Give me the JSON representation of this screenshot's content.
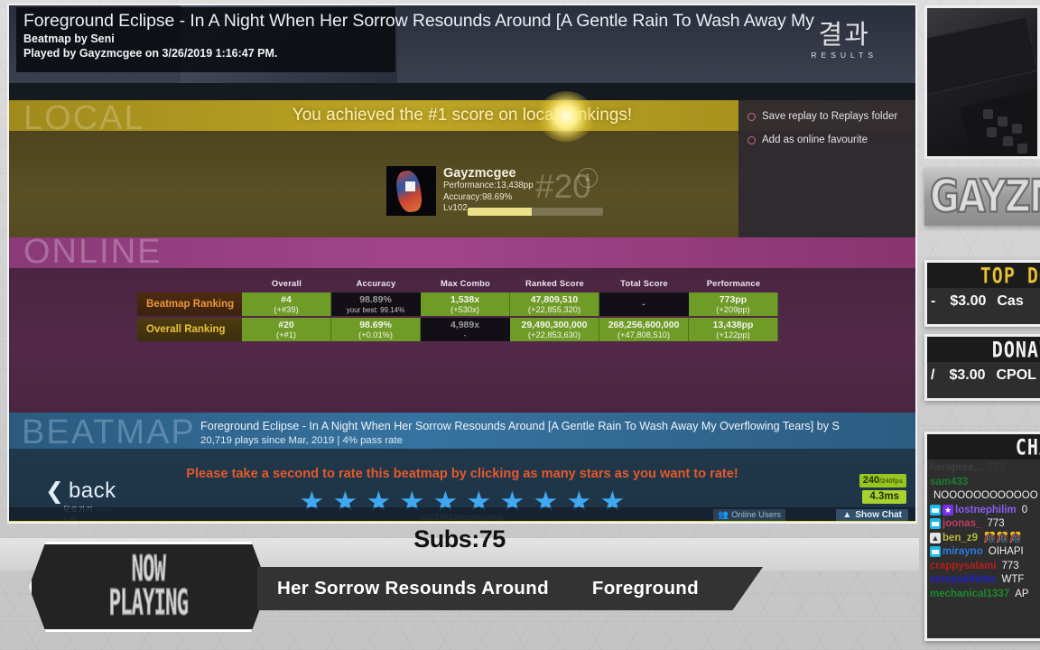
{
  "osu": {
    "song_title": "Foreground Eclipse - In A Night When Her Sorrow Resounds Around [A Gentle Rain To Wash Away My",
    "beatmap_by": "Beatmap by Seni",
    "played_by": "Played by Gayzmcgee on 3/26/2019 1:16:47 PM.",
    "results_kr": "결과",
    "results_en": "RESULTS",
    "achievement": "You achieved the #1 score on local rankings!",
    "watermarks": {
      "local": "LOCAL",
      "online": "ONLINE",
      "beatmap": "BEATMAP"
    },
    "options": [
      {
        "label": "Save replay to Replays folder"
      },
      {
        "label": "Add as online favourite"
      }
    ],
    "score_card": {
      "username": "Gayzmcgee",
      "performance": "Performance:13,438pp",
      "accuracy": "Accuracy:98.69%",
      "level": "Lv102",
      "rank": "#20",
      "rank_badge": "1",
      "level_progress_pct": 47
    },
    "rank_table": {
      "columns": [
        "Overall",
        "Accuracy",
        "Max Combo",
        "Ranked Score",
        "Total Score",
        "Performance"
      ],
      "rows": [
        {
          "label": "Beatmap Ranking",
          "cells": [
            {
              "v1": "#4",
              "v2": "(+#39)",
              "style": "green"
            },
            {
              "v1": "98.89%",
              "v2": "your best: 99.14%",
              "style": "dark"
            },
            {
              "v1": "1,538x",
              "v2": "(+530x)",
              "style": "green"
            },
            {
              "v1": "47,809,510",
              "v2": "(+22,855,320)",
              "style": "green"
            },
            {
              "v1": "-",
              "v2": "",
              "style": "dark"
            },
            {
              "v1": "773pp",
              "v2": "(+209pp)",
              "style": "green"
            }
          ]
        },
        {
          "label": "Overall Ranking",
          "cells": [
            {
              "v1": "#20",
              "v2": "(+#1)",
              "style": "green"
            },
            {
              "v1": "98.69%",
              "v2": "(+0.01%)",
              "style": "green"
            },
            {
              "v1": "4,989x",
              "v2": "-",
              "style": "dark"
            },
            {
              "v1": "29,490,300,000",
              "v2": "(+22,853,630)",
              "style": "green"
            },
            {
              "v1": "268,256,600,000",
              "v2": "(+47,808,510)",
              "style": "green"
            },
            {
              "v1": "13,438pp",
              "v2": "(+122pp)",
              "style": "green"
            }
          ]
        }
      ]
    },
    "beatmap_info": {
      "title": "Foreground Eclipse - In A Night When Her Sorrow Resounds Around [A Gentle Rain To Wash Away My Overflowing Tears] by S",
      "stats": "20,719 plays since Mar, 2019 | 4% pass rate"
    },
    "rate_prompt": "Please take a second to rate this beatmap by clicking as many stars as you want to rate!",
    "star_count": 10,
    "star_glyph": "★",
    "back_button": {
      "chevron": "❮",
      "label": "back",
      "kr": "뒤로가기 ------- ⊙"
    },
    "version": "b20190326cuttingedge",
    "fps": {
      "value": "240",
      "suffix": "/240fps",
      "latency": "4.3ms"
    },
    "online_users": "Online Users",
    "show_chat": "Show Chat",
    "show_chat_arrow": "▲"
  },
  "sidebar": {
    "logo_text": "GAYZM",
    "top_donator": {
      "heading": "TOP DO",
      "amount": "$3.00",
      "name": "Cas",
      "prefix": "-"
    },
    "donation": {
      "heading": "DONAT",
      "amount": "$3.00",
      "name": "CPOL",
      "prefix": "/"
    },
    "chat": {
      "heading": "CHA",
      "lines": [
        {
          "badges": [],
          "name": "harapree...",
          "name_color": "#3d3d3d",
          "text": "779",
          "text_color": "#3a3a3a"
        },
        {
          "badges": [],
          "name": "sam433",
          "name_color": "#1f7a33",
          "text": "",
          "text_color": "#f0f0f0"
        },
        {
          "badges": [],
          "name": "",
          "name_color": "#f0f0f0",
          "text": "NOOOOOOOOOOOO",
          "text_color": "#f0f0f0"
        },
        {
          "badges": [
            "sub",
            "mod"
          ],
          "name": "lostnephilim",
          "name_color": "#8a5cf0",
          "text": "0",
          "text_color": "#f0f0f0"
        },
        {
          "badges": [
            "sub"
          ],
          "name": "joonas_",
          "name_color": "#c03a6a",
          "text": "773",
          "text_color": "#f0f0f0"
        },
        {
          "badges": [
            "pr"
          ],
          "name": "ben_z9",
          "name_color": "#b8b83a",
          "text": "🎊🎊🎊",
          "text_color": "#f0f0f0"
        },
        {
          "badges": [
            "sub"
          ],
          "name": "mirayno",
          "name_color": "#2b7ae0",
          "text": "OIHAPI",
          "text_color": "#f0f0f0"
        },
        {
          "badges": [],
          "name": "crappysalami",
          "name_color": "#b4201c",
          "text": "773",
          "text_color": "#f0f0f0"
        },
        {
          "badges": [],
          "name": "zeroyukihime",
          "name_color": "#2020c8",
          "text": "WTF",
          "text_color": "#f0f0f0"
        },
        {
          "badges": [],
          "name": "mechanical1337",
          "name_color": "#1c8a2c",
          "text": "AP",
          "text_color": "#f0f0f0"
        }
      ]
    }
  },
  "now_playing": {
    "subs_label": "Subs:75",
    "badge_line1": "NOW",
    "badge_line2": "PLAYING",
    "track_part1": "Her Sorrow Resounds Around",
    "track_part2": "Foreground"
  }
}
